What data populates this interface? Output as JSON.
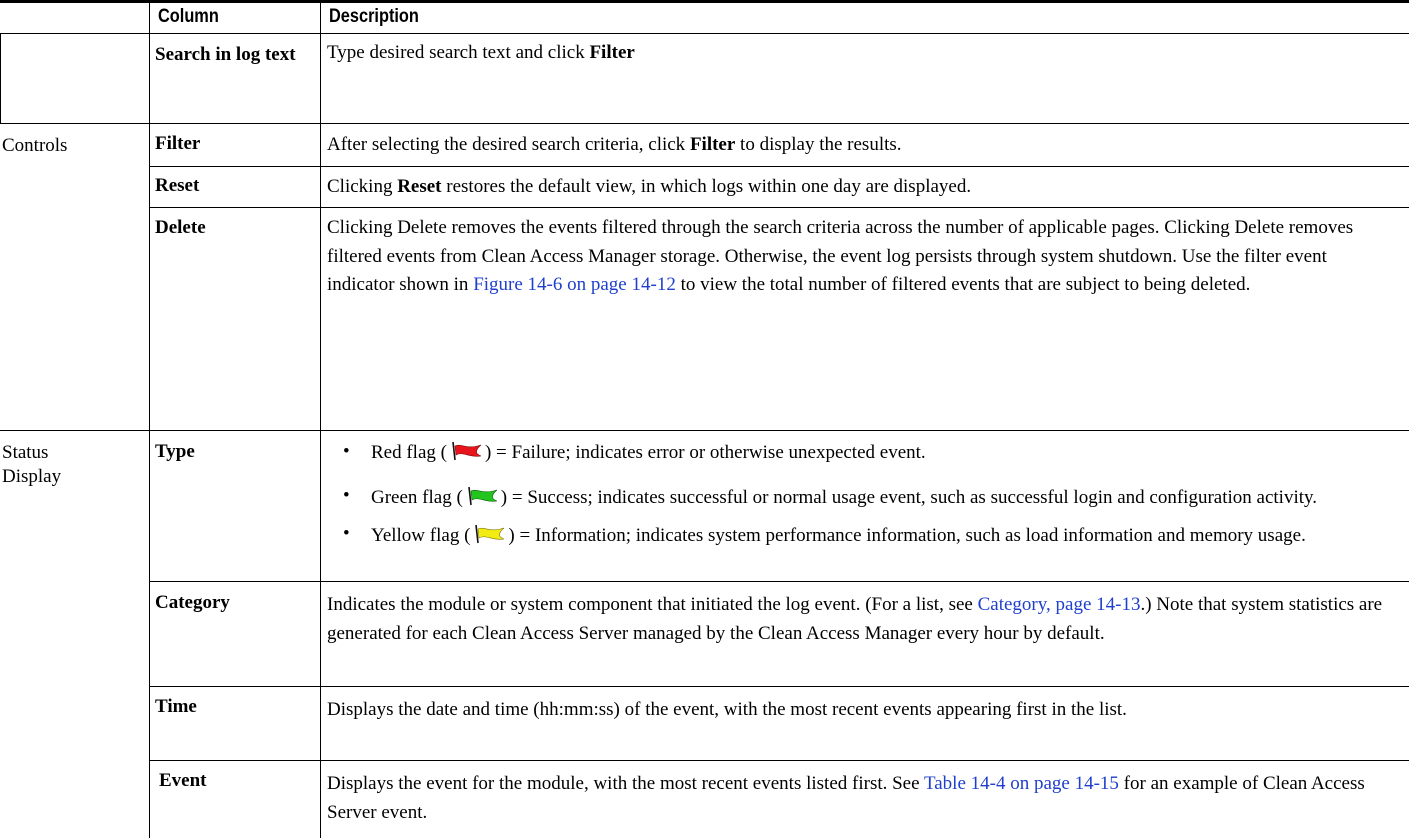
{
  "table": {
    "headers": {
      "column": "Column",
      "description": "Description"
    },
    "groups": {
      "controls": "Controls",
      "status_display": "Status Display"
    },
    "rows": {
      "search": {
        "term": "Search in log text",
        "d1": "Type desired search text and click ",
        "b1": "Filter"
      },
      "filter": {
        "term": "Filter",
        "d1": "After selecting the desired search criteria, click ",
        "b1": "Filter",
        "d2": " to display the results."
      },
      "reset": {
        "term": "Reset",
        "d1": "Clicking ",
        "b1": "Reset",
        "d2": " restores the default view, in which logs within one day are displayed."
      },
      "delete": {
        "term": "Delete",
        "d1": "Clicking Delete removes the events filtered through the search criteria across the number of applicable pages. Clicking Delete removes filtered events from Clean Access Manager storage. Otherwise, the event log persists through system shutdown. Use the filter event indicator shown in ",
        "link": "Figure 14-6 on page 14-12",
        "d2": " to view the total number of filtered events that are subject to being deleted."
      },
      "type": {
        "term": "Type",
        "bullets": [
          {
            "before": "Red flag (",
            "after": ") = Failure; indicates error or otherwise unexpected event.",
            "flag": "red-flag-icon",
            "color": "#e8141c"
          },
          {
            "before": "Green flag (",
            "after": ") = Success; indicates successful or normal usage event, such as successful login and configuration activity.",
            "flag": "green-flag-icon",
            "color": "#22c41e"
          },
          {
            "before": "Yellow flag (",
            "after": ") = Information; indicates system performance information, such as load information and memory usage.",
            "flag": "yellow-flag-icon",
            "color": "#f2ec14"
          }
        ]
      },
      "category": {
        "term": "Category",
        "d1": "Indicates the module or system component that initiated the log event. (For a list, see ",
        "link": "Category, page 14-13",
        "d2": ".) Note that system statistics are generated for each Clean Access Server managed by the Clean Access Manager every hour by default."
      },
      "time": {
        "term": "Time",
        "d1": "Displays the date and time (hh:mm:ss) of the event, with the most recent events appearing first in the list."
      },
      "event": {
        "term": "Event",
        "d1": "Displays the event for the module, with the most recent events listed first. See ",
        "link": "Table 14-4 on page 14-15",
        "d2": " for an example of Clean Access Server event."
      }
    },
    "colors": {
      "link": "#1f3fcc",
      "rule": "#000000"
    }
  }
}
